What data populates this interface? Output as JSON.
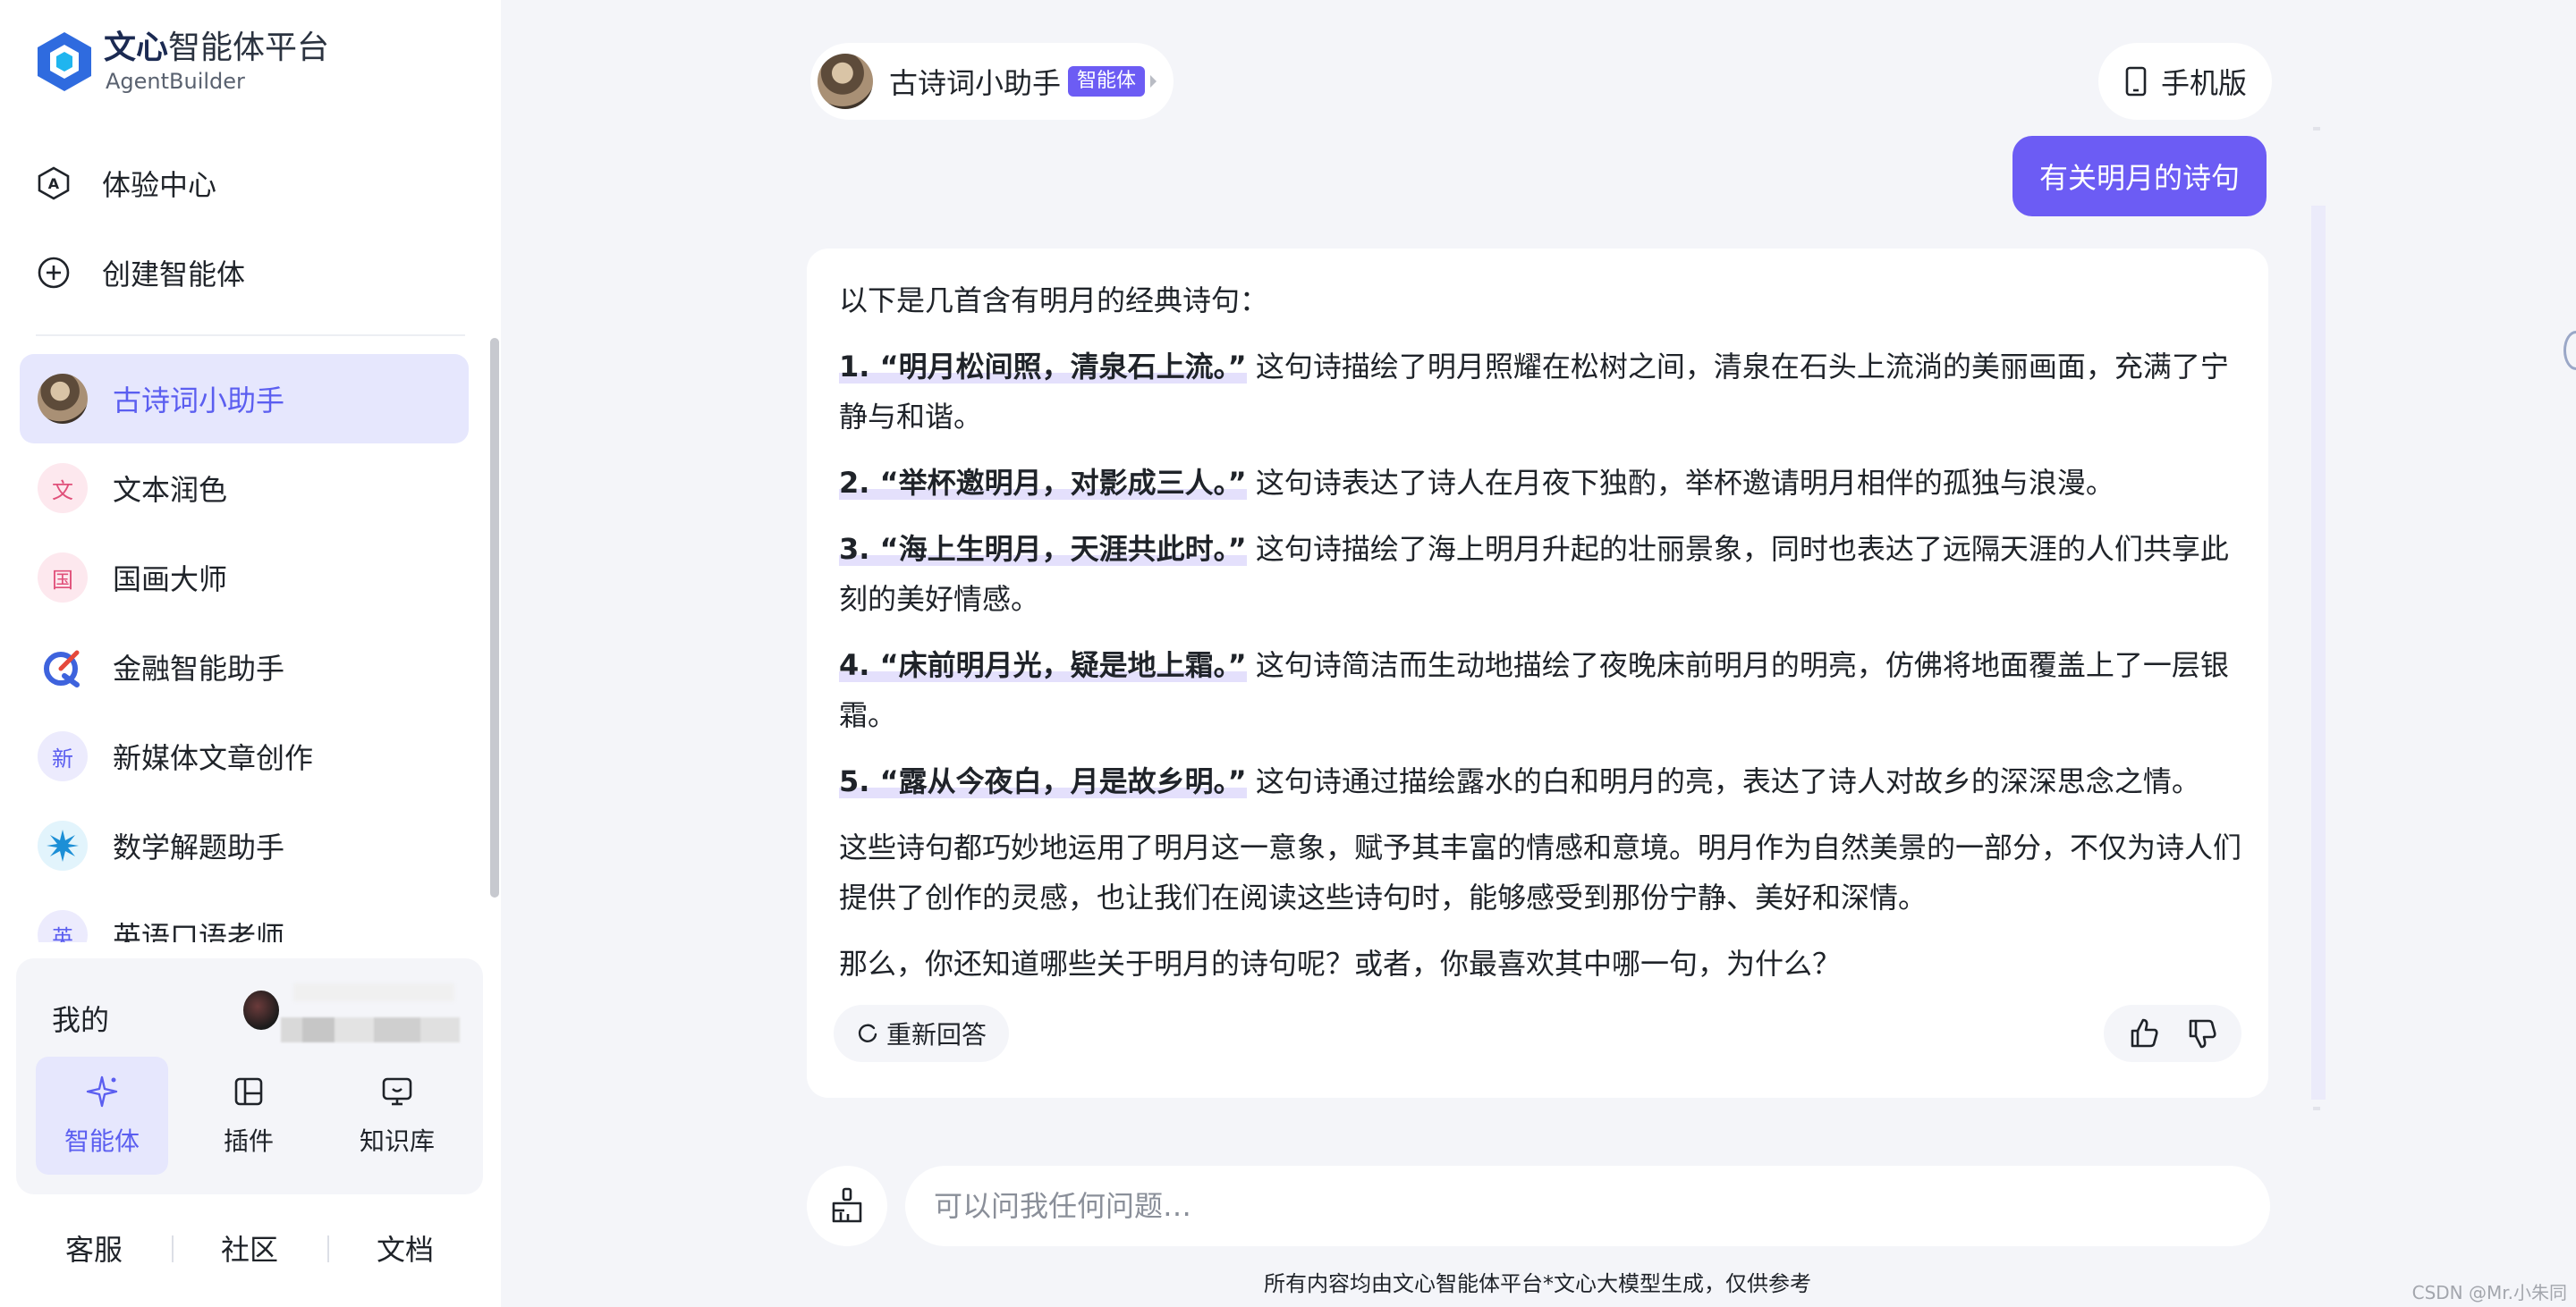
{
  "brand": {
    "title_bold": "文心",
    "title_rest": "智能体平台",
    "subtitle": "AgentBuilder"
  },
  "nav": {
    "experience": "体验中心",
    "create": "创建智能体"
  },
  "agents": [
    {
      "label": "古诗词小助手",
      "avatar": "",
      "active": true
    },
    {
      "label": "文本润色",
      "avatar": "文",
      "color": "#e0507a"
    },
    {
      "label": "国画大师",
      "avatar": "国",
      "color": "#e0507a"
    },
    {
      "label": "金融智能助手",
      "avatar": "",
      "color": "#3e63dd"
    },
    {
      "label": "新媒体文章创作",
      "avatar": "新",
      "color": "#5b5ef0"
    },
    {
      "label": "数学解题助手",
      "avatar": "",
      "color": "#2aa6e0"
    },
    {
      "label": "英语口语老师",
      "avatar": "英",
      "color": "#5b5ef0"
    }
  ],
  "mine": {
    "label": "我的",
    "tabs": [
      "智能体",
      "插件",
      "知识库"
    ]
  },
  "footer": [
    "客服",
    "社区",
    "文档"
  ],
  "header": {
    "agent_name": "古诗词小助手",
    "tag": "智能体",
    "mobile_label": "手机版"
  },
  "user_message": "有关明月的诗句",
  "answer": {
    "intro": "以下是几首含有明月的经典诗句：",
    "items": [
      {
        "num": "1.",
        "quote": "“明月松间照，清泉石上流。”",
        "desc": "这句诗描绘了明月照耀在松树之间，清泉在石头上流淌的美丽画面，充满了宁静与和谐。"
      },
      {
        "num": "2.",
        "quote": "“举杯邀明月，对影成三人。”",
        "desc": "这句诗表达了诗人在月夜下独酌，举杯邀请明月相伴的孤独与浪漫。"
      },
      {
        "num": "3.",
        "quote": "“海上生明月，天涯共此时。”",
        "desc": "这句诗描绘了海上明月升起的壮丽景象，同时也表达了远隔天涯的人们共享此刻的美好情感。"
      },
      {
        "num": "4.",
        "quote": "“床前明月光，疑是地上霜。”",
        "desc": "这句诗简洁而生动地描绘了夜晚床前明月的明亮，仿佛将地面覆盖上了一层银霜。"
      },
      {
        "num": "5.",
        "quote": "“露从今夜白，月是故乡明。”",
        "desc": "这句诗通过描绘露水的白和明月的亮，表达了诗人对故乡的深深思念之情。"
      }
    ],
    "summary": "这些诗句都巧妙地运用了明月这一意象，赋予其丰富的情感和意境。明月作为自然美景的一部分，不仅为诗人们提供了创作的灵感，也让我们在阅读这些诗句时，能够感受到那份宁静、美好和深情。",
    "question": "那么，你还知道哪些关于明月的诗句呢？或者，你最喜欢其中哪一句，为什么？",
    "regenerate": "重新回答"
  },
  "input": {
    "placeholder": "可以问我任何问题…"
  },
  "disclaimer": "所有内容均由文心智能体平台*文心大模型生成，仅供参考",
  "watermark": "CSDN @Mr.小朱同学",
  "colors": {
    "accent": "#6c5cf4",
    "active_bg": "#e6e7fd",
    "active_text": "#5b5ef0",
    "page_bg": "#f4f5f9"
  }
}
